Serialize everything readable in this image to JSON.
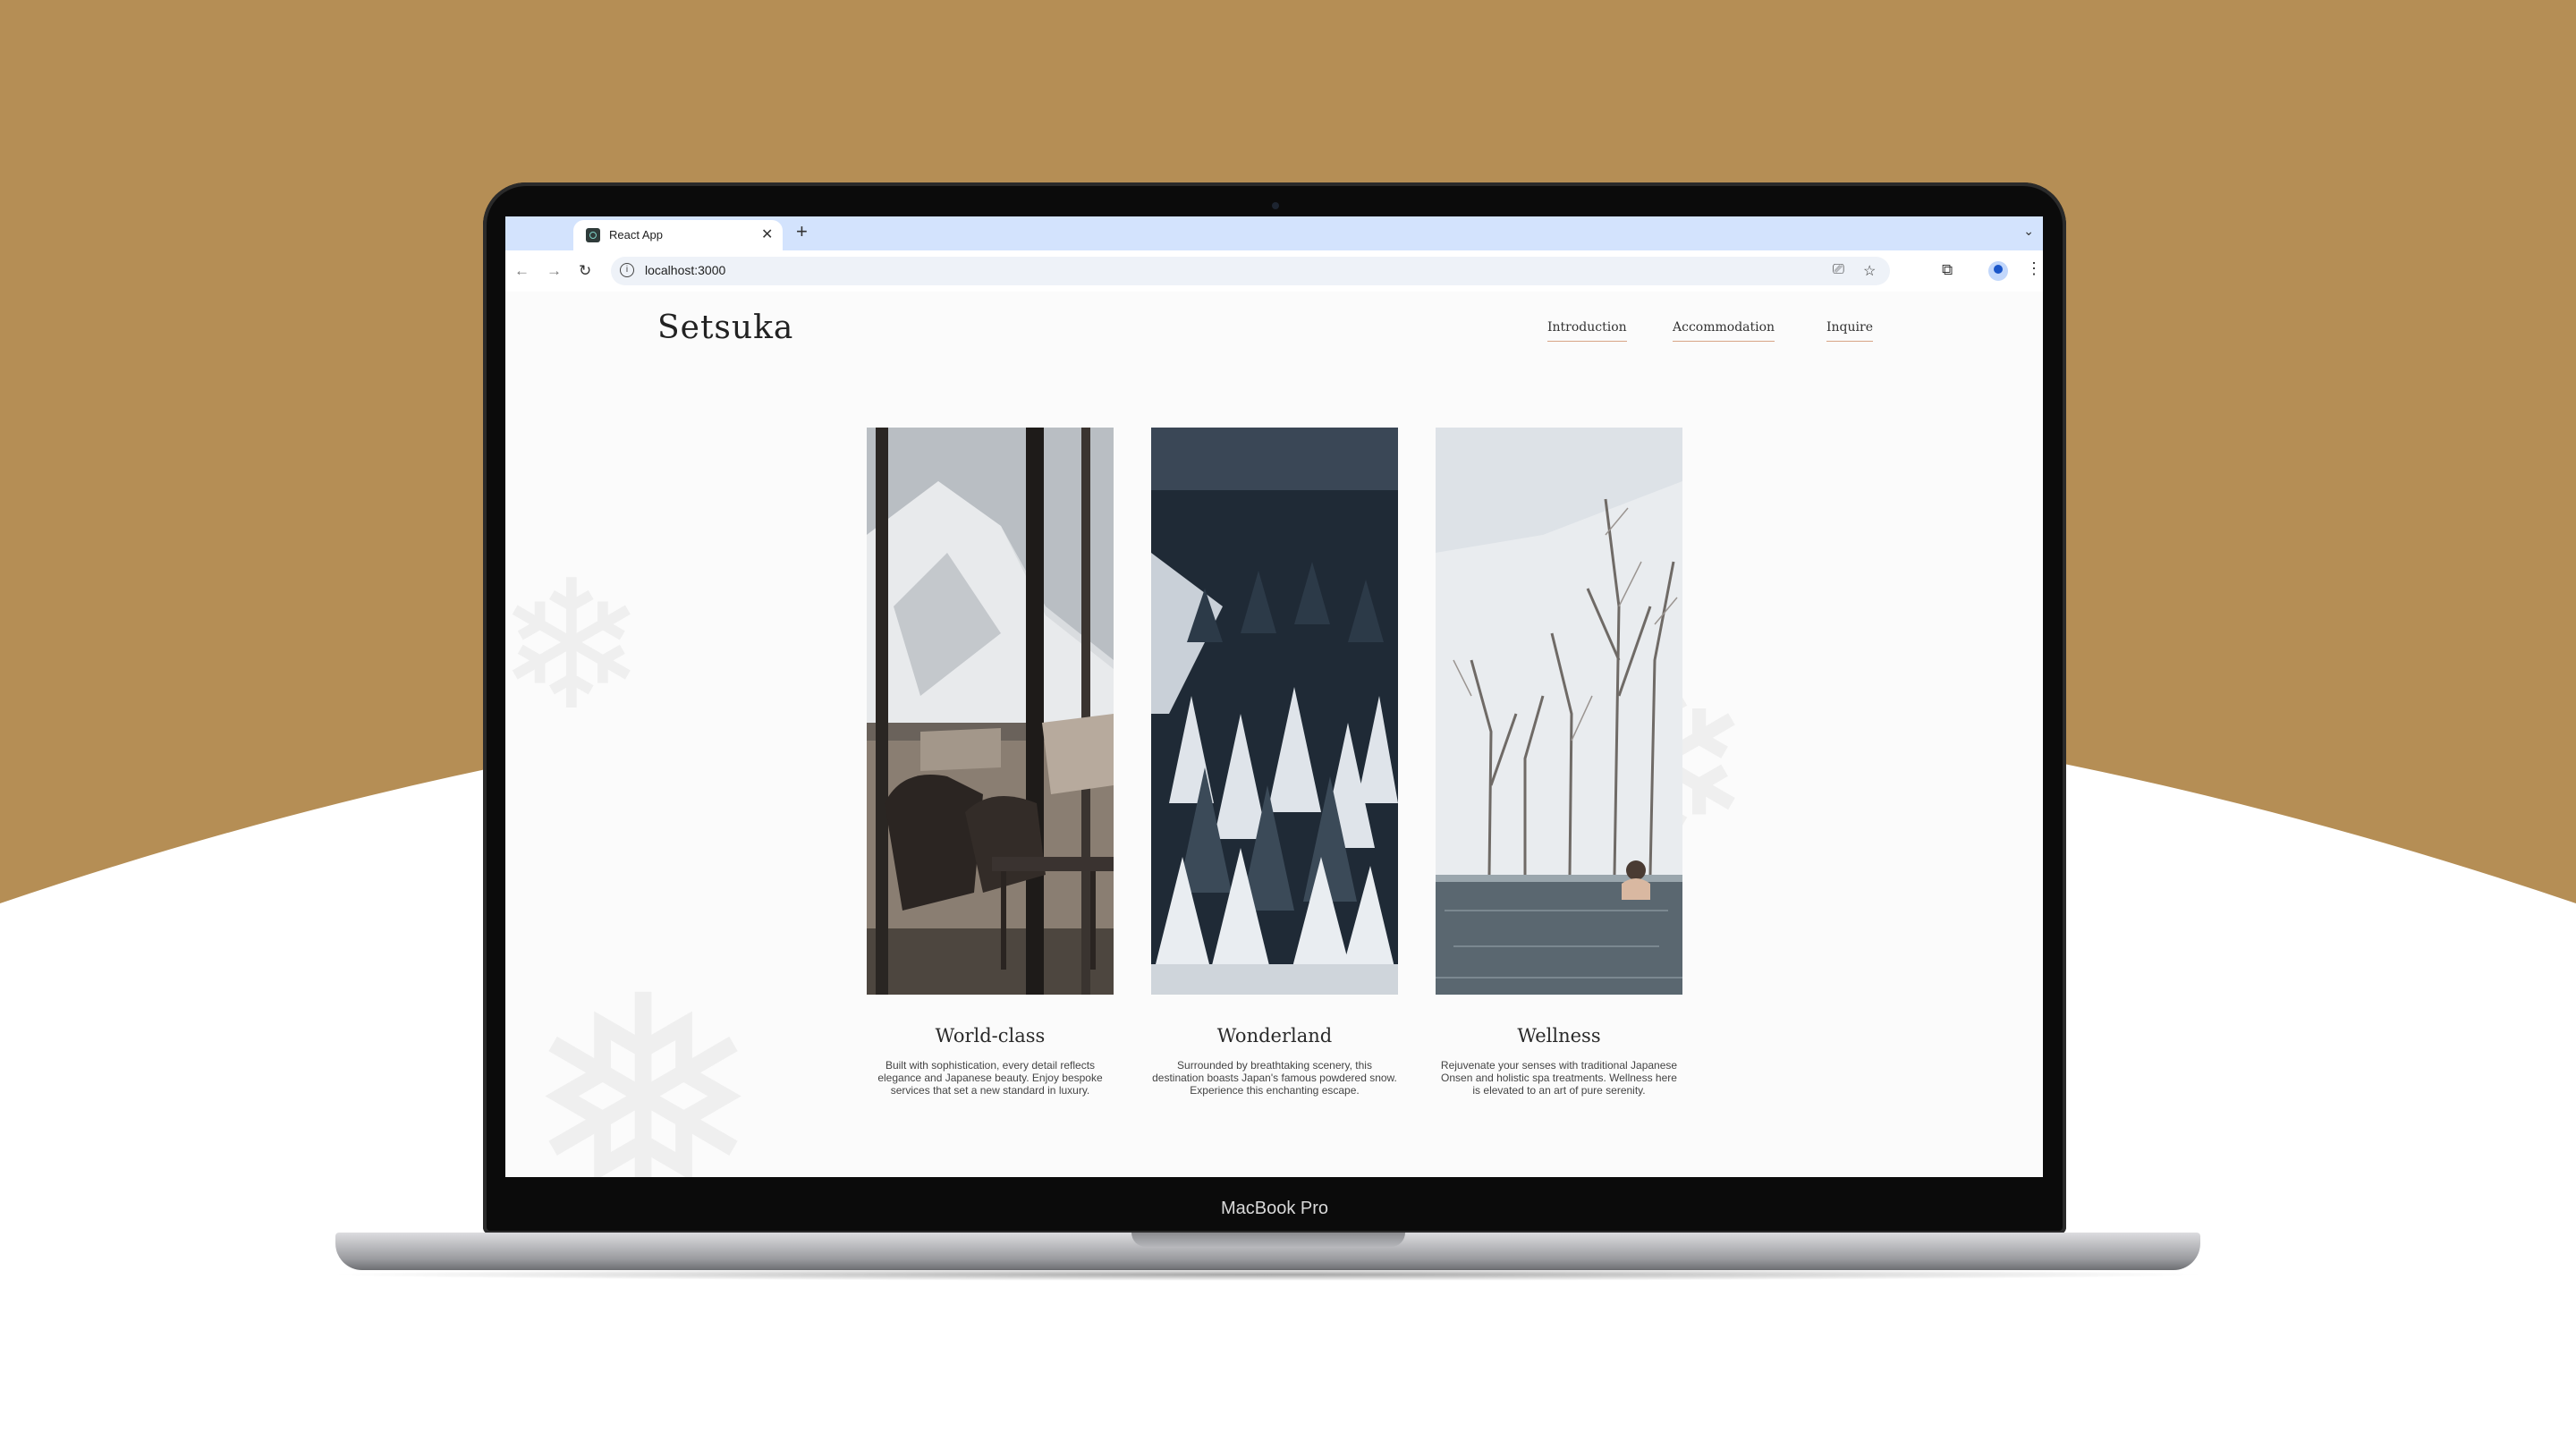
{
  "browser": {
    "tab_title": "React App",
    "tab_close": "✕",
    "new_tab": "+",
    "tab_menu": "⌄",
    "url": "localhost:3000"
  },
  "site": {
    "logo": "Setsuka",
    "nav": [
      "Introduction",
      "Accommodation",
      "Inquire"
    ]
  },
  "cards": [
    {
      "title": "World-class",
      "description": "Built with sophistication, every detail reflects elegance and Japanese beauty. Enjoy bespoke services that set a new standard in luxury."
    },
    {
      "title": "Wonderland",
      "description": "Surrounded by breathtaking scenery, this destination boasts Japan's famous powdered snow. Experience this enchanting escape."
    },
    {
      "title": "Wellness",
      "description": "Rejuvenate your senses with traditional Japanese Onsen and holistic spa treatments. Wellness here is elevated to an art of pure serenity."
    }
  ],
  "device": {
    "label": "MacBook Pro"
  },
  "colors": {
    "background": "#b58e55",
    "nav_underline": "#d7a485",
    "tab_strip": "#d3e3fd"
  },
  "icons": [
    "back-icon",
    "forward-icon",
    "reload-icon",
    "site-info-icon",
    "cast-icon",
    "bookmark-star-icon",
    "extensions-icon",
    "profile-icon",
    "menu-icon"
  ]
}
